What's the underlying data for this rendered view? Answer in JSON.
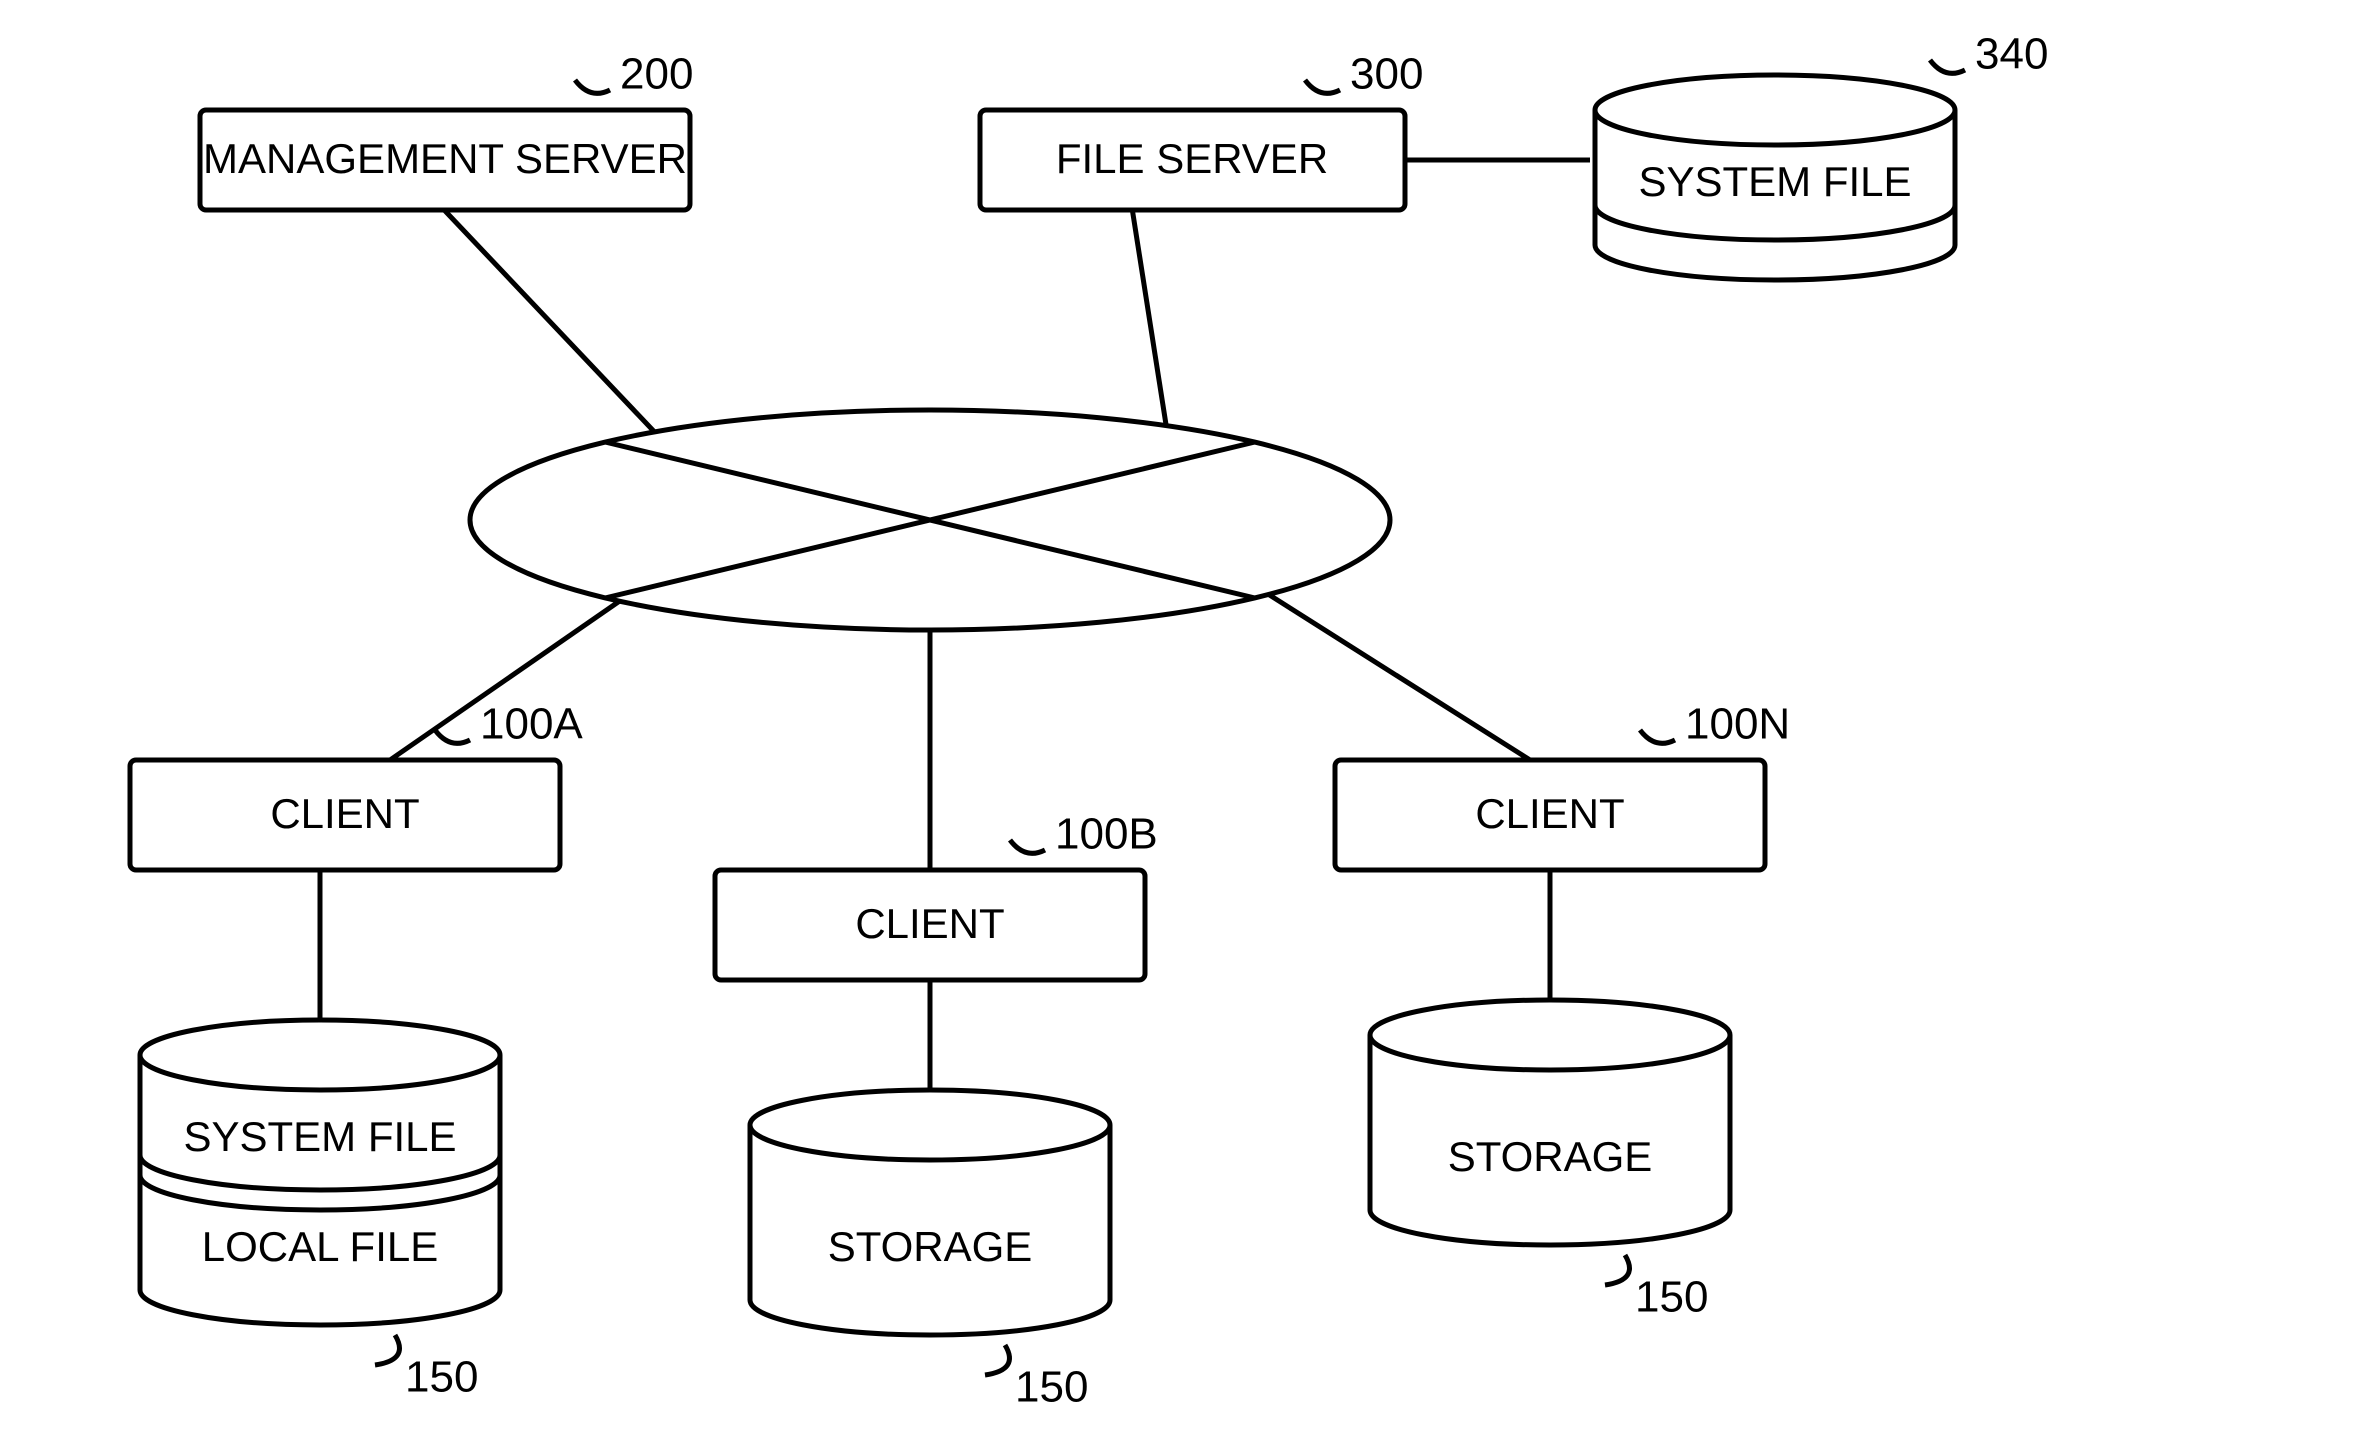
{
  "nodes": {
    "mgmt": {
      "label": "MANAGEMENT SERVER",
      "ref": "200"
    },
    "fsrv": {
      "label": "FILE SERVER",
      "ref": "300"
    },
    "sfile": {
      "label": "SYSTEM FILE",
      "ref": "340"
    },
    "cliA": {
      "label": "CLIENT",
      "ref": "100A"
    },
    "cliB": {
      "label": "CLIENT",
      "ref": "100B"
    },
    "cliN": {
      "label": "CLIENT",
      "ref": "100N"
    },
    "storA": {
      "label_top": "SYSTEM FILE",
      "label_bot": "LOCAL FILE",
      "ref": "150"
    },
    "storB": {
      "label": "STORAGE",
      "ref": "150"
    },
    "storN": {
      "label": "STORAGE",
      "ref": "150"
    }
  }
}
